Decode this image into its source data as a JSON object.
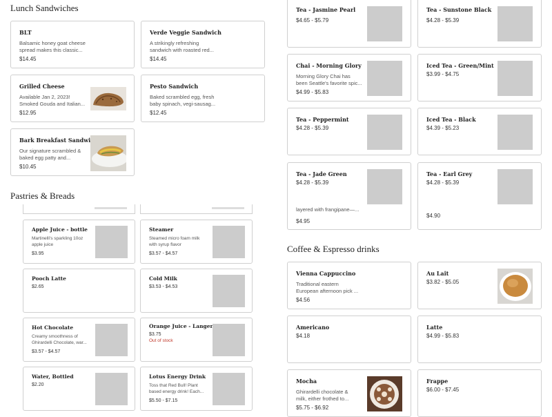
{
  "sections": {
    "lunch": "Lunch Sandwiches",
    "pastries": "Pastries & Breads",
    "coffee": "Coffee & Espresso drinks"
  },
  "lunch": [
    {
      "name": "BLT",
      "desc1": "Balsamic honey goat cheese",
      "desc2": "spread makes this classic...",
      "price": "$14.45"
    },
    {
      "name": "Verde Veggie Sandwich",
      "desc1": "A strikingly refreshing",
      "desc2": "sandwich with roasted red...",
      "price": "$14.45"
    },
    {
      "name": "Grilled Cheese",
      "desc1": "Available Jan 2, 2023!",
      "desc2": "Smoked Gouda and Italian...",
      "price": "$12.95"
    },
    {
      "name": "Pesto Sandwich",
      "desc1": "Baked scrambled egg, fresh",
      "desc2": "baby spinach, vegi-sausag...",
      "price": "$12.45"
    },
    {
      "name": "Bark Breakfast Sandwich",
      "desc1": "Our signature scrambled &",
      "desc2": "baked egg patty and...",
      "price": "$10.45"
    }
  ],
  "pastries": [
    {
      "name": "Apple Juice - bottle",
      "desc1": "Martinelli's sparkling 10oz",
      "desc2": "apple juice",
      "price": "$3.95"
    },
    {
      "name": "Steamer",
      "desc1": "Steamed micro foam milk",
      "desc2": "with syrup flavor",
      "price": "$3.57 - $4.57"
    },
    {
      "name": "Pooch Latte",
      "price": "$2.65"
    },
    {
      "name": "Cold Milk",
      "price": "$3.53 - $4.53"
    },
    {
      "name": "Hot Chocolate",
      "desc1": "Creamy smoothness of",
      "desc2": "Ghirardelli Chocolate, war...",
      "price": "$3.57 - $4.57"
    },
    {
      "name": "Orange Juice - Langers",
      "price": "$3.75",
      "stock": "Out of stock"
    },
    {
      "name": "Water, Bottled",
      "price": "$2.20"
    },
    {
      "name": "Lotus Energy Drink",
      "desc1": "Toss that Red Bull! Plant",
      "desc2": "based energy drink! Each...",
      "price": "$5.50 - $7.15"
    }
  ],
  "tea": [
    {
      "name": "Tea - Jasmine Pearl",
      "price": "$4.65 - $5.79"
    },
    {
      "name": "Tea - Sunstone Black",
      "price": "$4.28 - $5.39"
    },
    {
      "name": "Chai - Morning Glory",
      "desc1": "Morning Glory Chai has",
      "desc2": "been Seattle's favorite spic...",
      "price": "$4.99 - $5.83"
    },
    {
      "name": "Iced Tea - Green/Mint",
      "price": "$3.99 - $4.75"
    },
    {
      "name": "Tea - Peppermint",
      "price": "$4.28 - $5.39"
    },
    {
      "name": "Iced Tea - Black",
      "price": "$4.39 - $5.23"
    },
    {
      "name": "Tea - Jade Green",
      "price": "$4.28 - $5.39"
    },
    {
      "name": "Tea - Earl Grey",
      "price": "$4.28 - $5.39"
    }
  ],
  "partial": {
    "left_desc": "layered with frangipane—...",
    "left_price": "$4.95",
    "right_price": "$4.90"
  },
  "coffee": [
    {
      "name": "Vienna Cappuccino",
      "desc1": "Traditional eastern",
      "desc2": "European afternoon pick ...",
      "price": "$4.56"
    },
    {
      "name": "Au Lait",
      "price": "$3.82 - $5.05"
    },
    {
      "name": "Americano",
      "price": "$4.18"
    },
    {
      "name": "Latte",
      "price": "$4.99 - $5.83"
    },
    {
      "name": "Mocha",
      "desc1": "Ghirardelli chocolate &",
      "desc2": "milk, either frothed to...",
      "price": "$5.75 - $6.92"
    },
    {
      "name": "Frappe",
      "price": "$6.00 - $7.45"
    }
  ]
}
